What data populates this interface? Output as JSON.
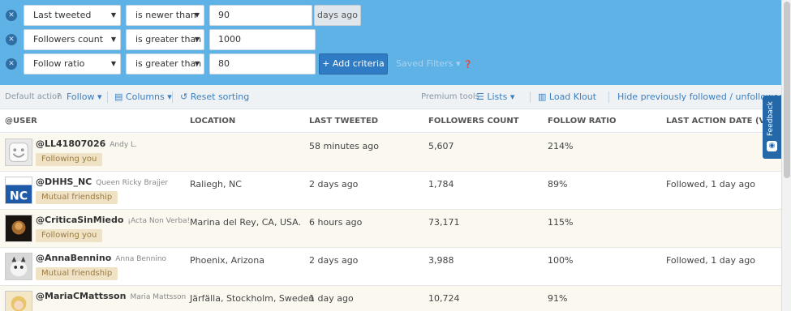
{
  "filters": {
    "rows": [
      {
        "field": "Last tweeted",
        "operator": "is newer than",
        "value": "90",
        "suffix": "days ago"
      },
      {
        "field": "Followers count",
        "operator": "is greater than",
        "value": "1000"
      },
      {
        "field": "Follow ratio",
        "operator": "is greater than",
        "value": "80"
      }
    ],
    "add_label": "+ Add criteria",
    "saved_label": "Saved Filters ▾"
  },
  "toolbar": {
    "default_action_label": "Default action",
    "follow_label": "Follow ▾",
    "columns_label": "Columns ▾",
    "reset_label": "Reset sorting",
    "premium_label": "Premium tools",
    "lists_label": "Lists ▾",
    "klout_label": "Load Klout",
    "hide_label": "Hide previously followed / unfollowed"
  },
  "table": {
    "headers": [
      "@USER",
      "LOCATION",
      "LAST TWEETED",
      "FOLLOWERS COUNT",
      "FOLLOW RATIO",
      "LAST ACTION DATE (VIA TW"
    ],
    "rows": [
      {
        "handle": "@LL41807026",
        "name": "Andy L.",
        "badge": "Following you",
        "location": "",
        "last_tweeted": "58 minutes ago",
        "followers": "5,607",
        "ratio": "214%",
        "last_action": "",
        "avatar": "smiley"
      },
      {
        "handle": "@DHHS_NC",
        "name": "Queen Ricky Brajjer",
        "badge": "Mutual friendship",
        "location": "Raliegh, NC",
        "last_tweeted": "2 days ago",
        "followers": "1,784",
        "ratio": "89%",
        "last_action": "Followed, 1 day ago",
        "avatar": "nc"
      },
      {
        "handle": "@CriticaSinMiedo",
        "name": "¡Acta Non Verba!",
        "badge": "Following you",
        "location": "Marina del Rey, CA, USA.",
        "last_tweeted": "6 hours ago",
        "followers": "73,171",
        "ratio": "115%",
        "last_action": "",
        "avatar": "dark"
      },
      {
        "handle": "@AnnaBennino",
        "name": "Anna Bennino",
        "badge": "Mutual friendship",
        "location": "Phoenix, Arizona",
        "last_tweeted": "2 days ago",
        "followers": "3,988",
        "ratio": "100%",
        "last_action": "Followed, 1 day ago",
        "avatar": "cat"
      },
      {
        "handle": "@MariaCMattsson",
        "name": "Maria Mattsson",
        "badge": "",
        "location": "Järfälla, Stockholm, Sweden",
        "last_tweeted": "1 day ago",
        "followers": "10,724",
        "ratio": "91%",
        "last_action": "",
        "avatar": "blonde"
      }
    ]
  },
  "feedback_label": "Feedback"
}
